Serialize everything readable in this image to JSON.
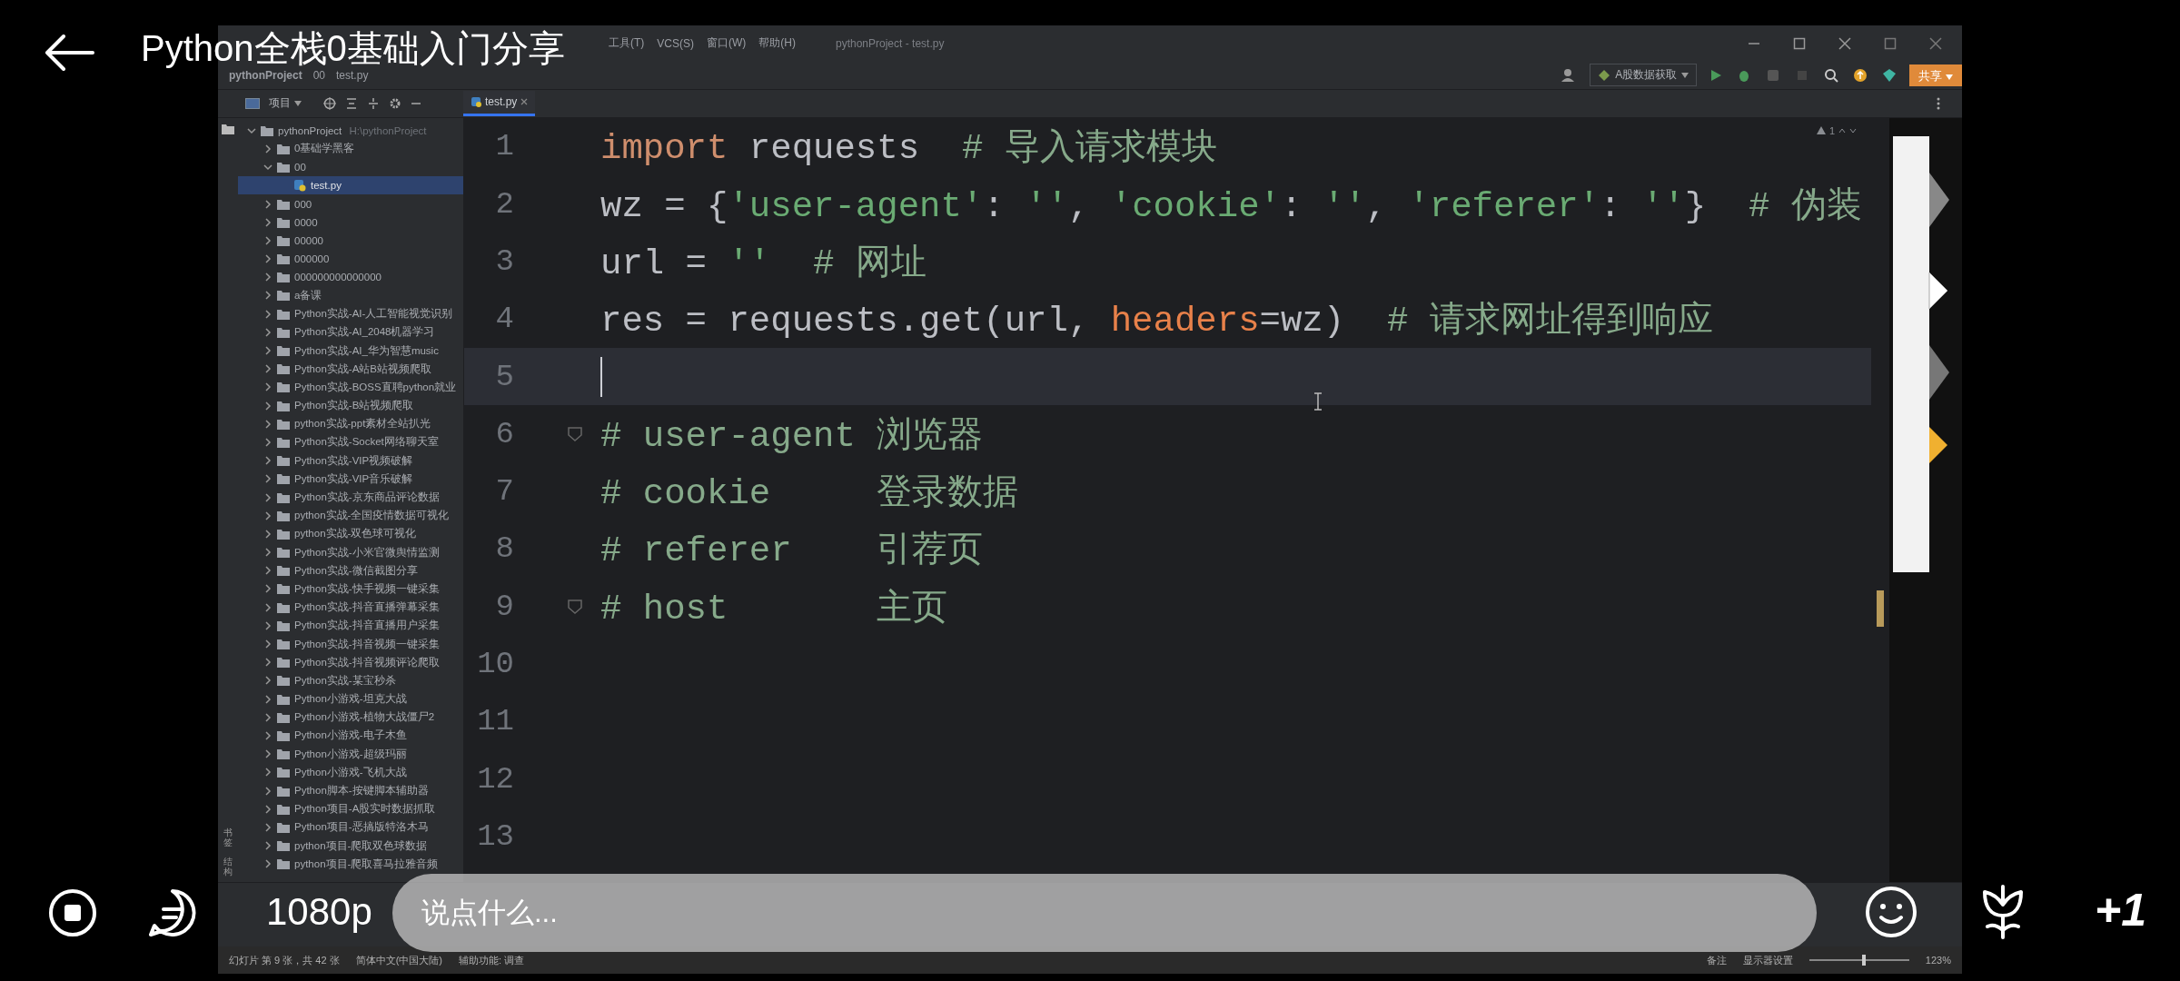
{
  "video": {
    "title": "Python全栈0基础入门分享",
    "quality": "1080p",
    "comment": {
      "placeholder": "说点什么..."
    },
    "plus_one": "+1"
  },
  "ide": {
    "menu": [
      "工具(T)",
      "VCS(S)",
      "窗口(W)",
      "帮助(H)"
    ],
    "window_title": "pythonProject - test.py",
    "breadcrumbs": [
      "pythonProject",
      "00",
      "test.py"
    ],
    "run_config": "A股数据获取",
    "share_button": "共享",
    "project_header": "项目",
    "left_strip": [
      "书签",
      "结构"
    ],
    "editor_tabs": [
      {
        "label": "test.py",
        "selected": true
      }
    ],
    "inspection_count": "1",
    "project_tree": {
      "label": "pythonProject",
      "path": "H:\\pythonProject",
      "expanded": true,
      "selected": false,
      "children": [
        {
          "kind": "folder",
          "label": "0基础学黑客",
          "expanded": false,
          "selected": false
        },
        {
          "kind": "folder",
          "label": "00",
          "expanded": true,
          "selected": false,
          "children": [
            {
              "kind": "file",
              "label": "test.py",
              "selected": true
            }
          ]
        },
        {
          "kind": "folder",
          "label": "000",
          "expanded": false,
          "selected": false
        },
        {
          "kind": "folder",
          "label": "0000",
          "expanded": false,
          "selected": false
        },
        {
          "kind": "folder",
          "label": "00000",
          "expanded": false,
          "selected": false
        },
        {
          "kind": "folder",
          "label": "000000",
          "expanded": false,
          "selected": false
        },
        {
          "kind": "folder",
          "label": "000000000000000",
          "expanded": false,
          "selected": false
        },
        {
          "kind": "folder",
          "label": "a备课",
          "expanded": false,
          "selected": false
        },
        {
          "kind": "folder",
          "label": "Python实战-AI-人工智能视觉识别",
          "expanded": false,
          "selected": false
        },
        {
          "kind": "folder",
          "label": "Python实战-AI_2048机器学习",
          "expanded": false,
          "selected": false
        },
        {
          "kind": "folder",
          "label": "Python实战-AI_华为智慧music",
          "expanded": false,
          "selected": false
        },
        {
          "kind": "folder",
          "label": "Python实战-A站B站视频爬取",
          "expanded": false,
          "selected": false
        },
        {
          "kind": "folder",
          "label": "Python实战-BOSS直聘python就业",
          "expanded": false,
          "selected": false
        },
        {
          "kind": "folder",
          "label": "Python实战-B站视频爬取",
          "expanded": false,
          "selected": false
        },
        {
          "kind": "folder",
          "label": "python实战-ppt素材全站扒光",
          "expanded": false,
          "selected": false
        },
        {
          "kind": "folder",
          "label": "Python实战-Socket网络聊天室",
          "expanded": false,
          "selected": false
        },
        {
          "kind": "folder",
          "label": "Python实战-VIP视频破解",
          "expanded": false,
          "selected": false
        },
        {
          "kind": "folder",
          "label": "Python实战-VIP音乐破解",
          "expanded": false,
          "selected": false
        },
        {
          "kind": "folder",
          "label": "Python实战-京东商品评论数据",
          "expanded": false,
          "selected": false
        },
        {
          "kind": "folder",
          "label": "python实战-全国疫情数据可视化",
          "expanded": false,
          "selected": false
        },
        {
          "kind": "folder",
          "label": "python实战-双色球可视化",
          "expanded": false,
          "selected": false
        },
        {
          "kind": "folder",
          "label": "Python实战-小米官微舆情监测",
          "expanded": false,
          "selected": false
        },
        {
          "kind": "folder",
          "label": "Python实战-微信截图分享",
          "expanded": false,
          "selected": false
        },
        {
          "kind": "folder",
          "label": "Python实战-快手视频一键采集",
          "expanded": false,
          "selected": false
        },
        {
          "kind": "folder",
          "label": "Python实战-抖音直播弹幕采集",
          "expanded": false,
          "selected": false
        },
        {
          "kind": "folder",
          "label": "Python实战-抖音直播用户采集",
          "expanded": false,
          "selected": false
        },
        {
          "kind": "folder",
          "label": "Python实战-抖音视频一键采集",
          "expanded": false,
          "selected": false
        },
        {
          "kind": "folder",
          "label": "Python实战-抖音视频评论爬取",
          "expanded": false,
          "selected": false
        },
        {
          "kind": "folder",
          "label": "Python实战-某宝秒杀",
          "expanded": false,
          "selected": false
        },
        {
          "kind": "folder",
          "label": "Python小游戏-坦克大战",
          "expanded": false,
          "selected": false
        },
        {
          "kind": "folder",
          "label": "Python小游戏-植物大战僵尸2",
          "expanded": false,
          "selected": false
        },
        {
          "kind": "folder",
          "label": "Python小游戏-电子木鱼",
          "expanded": false,
          "selected": false
        },
        {
          "kind": "folder",
          "label": "Python小游戏-超级玛丽",
          "expanded": false,
          "selected": false
        },
        {
          "kind": "folder",
          "label": "Python小游戏-飞机大战",
          "expanded": false,
          "selected": false
        },
        {
          "kind": "folder",
          "label": "Python脚本-按键脚本辅助器",
          "expanded": false,
          "selected": false
        },
        {
          "kind": "folder",
          "label": "Python项目-A股实时数据抓取",
          "expanded": false,
          "selected": false
        },
        {
          "kind": "folder",
          "label": "Python项目-恶搞版特洛木马",
          "expanded": false,
          "selected": false
        },
        {
          "kind": "folder",
          "label": "python项目-爬取双色球数据",
          "expanded": false,
          "selected": false
        },
        {
          "kind": "folder",
          "label": "python项目-爬取喜马拉雅音频",
          "expanded": false,
          "selected": false
        }
      ]
    },
    "code_lines": [
      {
        "number": "1",
        "current": false,
        "fold": false,
        "tokens": [
          {
            "kind": "keyword",
            "text": "import"
          },
          {
            "kind": "plain",
            "text": " requests  "
          },
          {
            "kind": "comment",
            "text": "# 导入请求模块"
          }
        ]
      },
      {
        "number": "2",
        "current": false,
        "fold": false,
        "tokens": [
          {
            "kind": "plain",
            "text": "wz = {"
          },
          {
            "kind": "string",
            "text": "'user-agent'"
          },
          {
            "kind": "plain",
            "text": ": "
          },
          {
            "kind": "string",
            "text": "''"
          },
          {
            "kind": "plain",
            "text": ", "
          },
          {
            "kind": "string",
            "text": "'cookie'"
          },
          {
            "kind": "plain",
            "text": ": "
          },
          {
            "kind": "string",
            "text": "''"
          },
          {
            "kind": "plain",
            "text": ", "
          },
          {
            "kind": "string",
            "text": "'referer'"
          },
          {
            "kind": "plain",
            "text": ": "
          },
          {
            "kind": "string",
            "text": "''"
          },
          {
            "kind": "plain",
            "text": "}  "
          },
          {
            "kind": "comment",
            "text": "# 伪装"
          }
        ]
      },
      {
        "number": "3",
        "current": false,
        "fold": false,
        "tokens": [
          {
            "kind": "plain",
            "text": "url = "
          },
          {
            "kind": "string",
            "text": "''"
          },
          {
            "kind": "comment",
            "text": "  # 网址"
          }
        ]
      },
      {
        "number": "4",
        "current": false,
        "fold": false,
        "tokens": [
          {
            "kind": "plain",
            "text": "res = requests.get(url, "
          },
          {
            "kind": "param",
            "text": "headers"
          },
          {
            "kind": "plain",
            "text": "=wz)  "
          },
          {
            "kind": "comment",
            "text": "# 请求网址得到响应"
          }
        ]
      },
      {
        "number": "5",
        "current": true,
        "fold": false
      },
      {
        "number": "6",
        "current": false,
        "fold": true,
        "tokens": [
          {
            "kind": "comment",
            "text": "# user-agent 浏览器"
          }
        ]
      },
      {
        "number": "7",
        "current": false,
        "fold": false,
        "tokens": [
          {
            "kind": "comment",
            "text": "# cookie     登录数据"
          }
        ]
      },
      {
        "number": "8",
        "current": false,
        "fold": false,
        "tokens": [
          {
            "kind": "comment",
            "text": "# referer    引荐页"
          }
        ]
      },
      {
        "number": "9",
        "current": false,
        "fold": true,
        "tokens": [
          {
            "kind": "comment",
            "text": "# host       主页"
          }
        ]
      },
      {
        "number": "10",
        "current": false,
        "fold": false
      },
      {
        "number": "11",
        "current": false,
        "fold": false
      },
      {
        "number": "12",
        "current": false,
        "fold": false
      },
      {
        "number": "13",
        "current": false,
        "fold": false
      }
    ]
  },
  "presentation_bar": {
    "left": [
      "幻灯片 第 9 张，共 42 张",
      "简体中文(中国大陆)",
      "辅助功能: 调查"
    ],
    "right": [
      "备注",
      "显示器设置"
    ],
    "zoom_slider": {
      "level": 0.55
    },
    "zoom": "123%"
  }
}
